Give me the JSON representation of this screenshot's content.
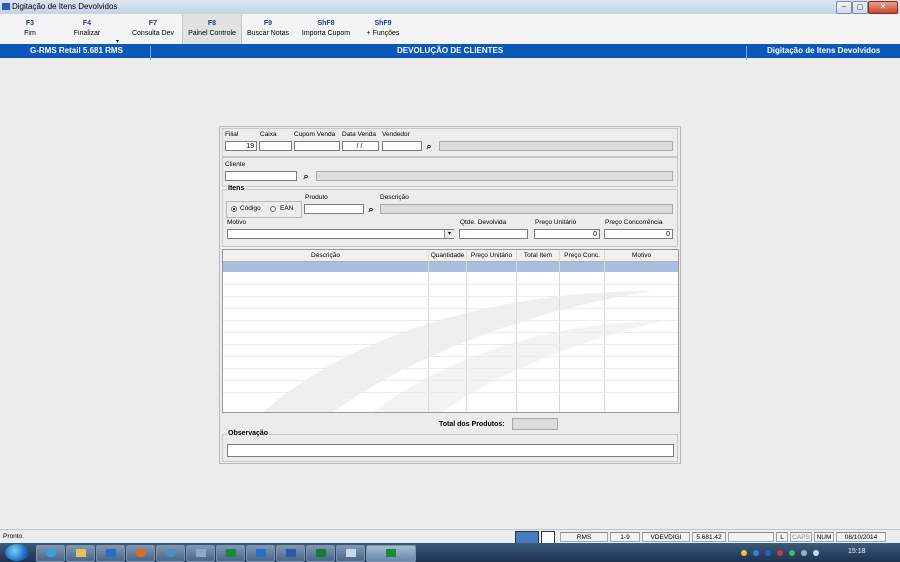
{
  "window": {
    "title": "Digitação de Itens Devolvidos",
    "btn_min": "–",
    "btn_max": "◻",
    "btn_close": "✕"
  },
  "toolbar": [
    {
      "key": "F3",
      "label": "Fim"
    },
    {
      "key": "F4",
      "label": "Finalizar"
    },
    {
      "key": "F7",
      "label": "Consulta Dev"
    },
    {
      "key": "F8",
      "label": "Painel Controle"
    },
    {
      "key": "F9",
      "label": "Buscar Notas"
    },
    {
      "key": "ShF8",
      "label": "Importa Cupom"
    },
    {
      "key": "ShF9",
      "label": "+ Funções"
    }
  ],
  "band": {
    "left": "G-RMS Retail 5.681 RMS",
    "center": "DEVOLUÇÃO DE CLIENTES",
    "right": "Digitação de Itens Devolvidos"
  },
  "form": {
    "filial_label": "Filial",
    "filial_value": "19",
    "caixa_label": "Caixa",
    "cupom_label": "Cupom Venda",
    "data_label": "Data Venda",
    "data_value": " / /",
    "vendedor_label": "Vendedor",
    "cliente_label": "Cliente",
    "itens_label": "Itens",
    "produto_label": "Produto",
    "descricao_label": "Descrição",
    "radio_codigo": "Código",
    "radio_ean": "EAN",
    "motivo_label": "Motivo",
    "qtde_label": "Qtde. Devolvida",
    "preco_unit_label": "Preço Unitário",
    "preco_unit_value": "0",
    "preco_conc_label": "Preço Concorrência",
    "preco_conc_value": "0"
  },
  "grid": {
    "columns": [
      "Descrição",
      "Quantidade",
      "Preço Unitário",
      "Total Item",
      "Preço Conc.",
      "Motivo"
    ]
  },
  "totals": {
    "label": "Total dos Produtos:"
  },
  "observacao": {
    "label": "Observação"
  },
  "status": {
    "text": "Pronto.",
    "cells": [
      "RMS",
      "1-9",
      "VDEVDIGI",
      "5.681.42",
      "",
      "L",
      "CAPS",
      "NUM",
      "08/10/2014"
    ]
  },
  "taskbar": {
    "clock": "15:18"
  },
  "icons": {
    "search": "binoculars-icon",
    "dropdown": "chevron-down-icon"
  }
}
